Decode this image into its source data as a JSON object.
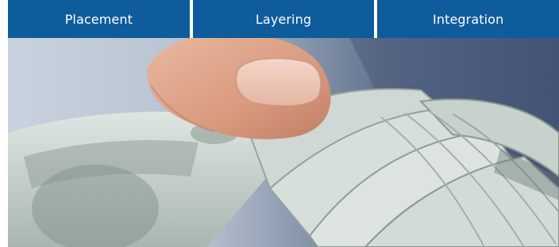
{
  "tabs": [
    {
      "label": "Placement"
    },
    {
      "label": "Layering"
    },
    {
      "label": "Integration"
    }
  ],
  "colors": {
    "tab_bg": "#0f5c9c",
    "tab_text": "#ffffff"
  },
  "hero": {
    "icon": "hand-holding-dollar-bills-photo"
  }
}
